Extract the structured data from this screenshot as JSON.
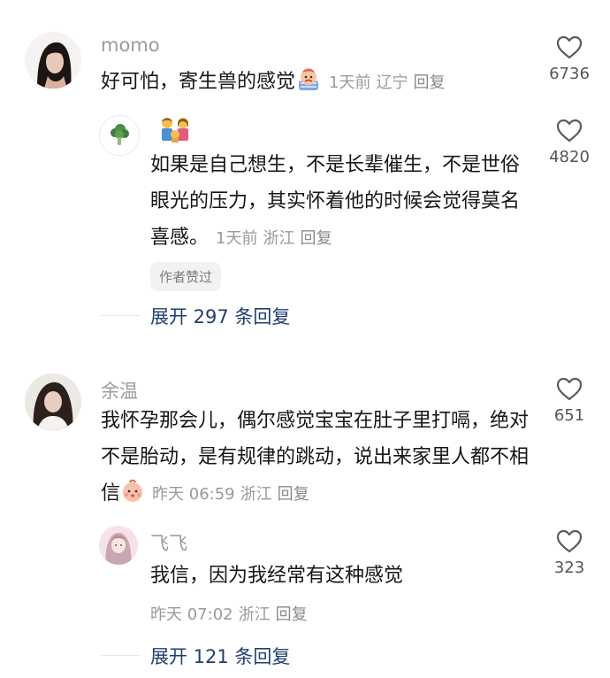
{
  "comments": [
    {
      "username": "momo",
      "text": "好可怕，寄生兽的感觉",
      "emoji": "crying-baby-emoji",
      "time": "1天前",
      "location": "辽宁",
      "reply_label": "回复",
      "likes": "6736",
      "replies": [
        {
          "username_emoji": "parents-emoji",
          "avatar_icon": "broccoli-icon",
          "text": "如果是自己想生，不是长辈催生，不是世俗眼光的压力，其实怀着他的时候会觉得莫名喜感。",
          "time": "1天前",
          "location": "浙江",
          "reply_label": "回复",
          "likes": "4820",
          "badge": "作者赞过"
        }
      ],
      "expand_label": "展开 297 条回复"
    },
    {
      "username": "余温",
      "text": "我怀孕那会儿，偶尔感觉宝宝在肚子里打嗝，绝对不是胎动，是有规律的跳动，说出来家里人都不相信",
      "emoji": "baby-face-emoji",
      "time": "昨天 06:59",
      "location": "浙江",
      "reply_label": "回复",
      "likes": "651",
      "replies": [
        {
          "username": "飞飞",
          "text": "我信，因为我经常有这种感觉",
          "time": "昨天 07:02",
          "location": "浙江",
          "reply_label": "回复",
          "likes": "323"
        }
      ],
      "expand_label": "展开 121 条回复"
    }
  ],
  "colors": {
    "username": "#9b9b9b",
    "meta": "#9a9a9a",
    "expand_link": "#1f3f72",
    "badge_bg": "#f2f2f2"
  }
}
